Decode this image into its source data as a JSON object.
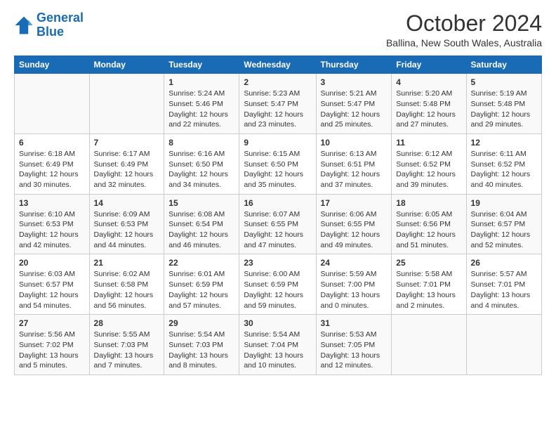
{
  "logo": {
    "line1": "General",
    "line2": "Blue"
  },
  "title": "October 2024",
  "location": "Ballina, New South Wales, Australia",
  "days_of_week": [
    "Sunday",
    "Monday",
    "Tuesday",
    "Wednesday",
    "Thursday",
    "Friday",
    "Saturday"
  ],
  "weeks": [
    [
      {
        "day": "",
        "info": ""
      },
      {
        "day": "",
        "info": ""
      },
      {
        "day": "1",
        "info": "Sunrise: 5:24 AM\nSunset: 5:46 PM\nDaylight: 12 hours and 22 minutes."
      },
      {
        "day": "2",
        "info": "Sunrise: 5:23 AM\nSunset: 5:47 PM\nDaylight: 12 hours and 23 minutes."
      },
      {
        "day": "3",
        "info": "Sunrise: 5:21 AM\nSunset: 5:47 PM\nDaylight: 12 hours and 25 minutes."
      },
      {
        "day": "4",
        "info": "Sunrise: 5:20 AM\nSunset: 5:48 PM\nDaylight: 12 hours and 27 minutes."
      },
      {
        "day": "5",
        "info": "Sunrise: 5:19 AM\nSunset: 5:48 PM\nDaylight: 12 hours and 29 minutes."
      }
    ],
    [
      {
        "day": "6",
        "info": "Sunrise: 6:18 AM\nSunset: 6:49 PM\nDaylight: 12 hours and 30 minutes."
      },
      {
        "day": "7",
        "info": "Sunrise: 6:17 AM\nSunset: 6:49 PM\nDaylight: 12 hours and 32 minutes."
      },
      {
        "day": "8",
        "info": "Sunrise: 6:16 AM\nSunset: 6:50 PM\nDaylight: 12 hours and 34 minutes."
      },
      {
        "day": "9",
        "info": "Sunrise: 6:15 AM\nSunset: 6:50 PM\nDaylight: 12 hours and 35 minutes."
      },
      {
        "day": "10",
        "info": "Sunrise: 6:13 AM\nSunset: 6:51 PM\nDaylight: 12 hours and 37 minutes."
      },
      {
        "day": "11",
        "info": "Sunrise: 6:12 AM\nSunset: 6:52 PM\nDaylight: 12 hours and 39 minutes."
      },
      {
        "day": "12",
        "info": "Sunrise: 6:11 AM\nSunset: 6:52 PM\nDaylight: 12 hours and 40 minutes."
      }
    ],
    [
      {
        "day": "13",
        "info": "Sunrise: 6:10 AM\nSunset: 6:53 PM\nDaylight: 12 hours and 42 minutes."
      },
      {
        "day": "14",
        "info": "Sunrise: 6:09 AM\nSunset: 6:53 PM\nDaylight: 12 hours and 44 minutes."
      },
      {
        "day": "15",
        "info": "Sunrise: 6:08 AM\nSunset: 6:54 PM\nDaylight: 12 hours and 46 minutes."
      },
      {
        "day": "16",
        "info": "Sunrise: 6:07 AM\nSunset: 6:55 PM\nDaylight: 12 hours and 47 minutes."
      },
      {
        "day": "17",
        "info": "Sunrise: 6:06 AM\nSunset: 6:55 PM\nDaylight: 12 hours and 49 minutes."
      },
      {
        "day": "18",
        "info": "Sunrise: 6:05 AM\nSunset: 6:56 PM\nDaylight: 12 hours and 51 minutes."
      },
      {
        "day": "19",
        "info": "Sunrise: 6:04 AM\nSunset: 6:57 PM\nDaylight: 12 hours and 52 minutes."
      }
    ],
    [
      {
        "day": "20",
        "info": "Sunrise: 6:03 AM\nSunset: 6:57 PM\nDaylight: 12 hours and 54 minutes."
      },
      {
        "day": "21",
        "info": "Sunrise: 6:02 AM\nSunset: 6:58 PM\nDaylight: 12 hours and 56 minutes."
      },
      {
        "day": "22",
        "info": "Sunrise: 6:01 AM\nSunset: 6:59 PM\nDaylight: 12 hours and 57 minutes."
      },
      {
        "day": "23",
        "info": "Sunrise: 6:00 AM\nSunset: 6:59 PM\nDaylight: 12 hours and 59 minutes."
      },
      {
        "day": "24",
        "info": "Sunrise: 5:59 AM\nSunset: 7:00 PM\nDaylight: 13 hours and 0 minutes."
      },
      {
        "day": "25",
        "info": "Sunrise: 5:58 AM\nSunset: 7:01 PM\nDaylight: 13 hours and 2 minutes."
      },
      {
        "day": "26",
        "info": "Sunrise: 5:57 AM\nSunset: 7:01 PM\nDaylight: 13 hours and 4 minutes."
      }
    ],
    [
      {
        "day": "27",
        "info": "Sunrise: 5:56 AM\nSunset: 7:02 PM\nDaylight: 13 hours and 5 minutes."
      },
      {
        "day": "28",
        "info": "Sunrise: 5:55 AM\nSunset: 7:03 PM\nDaylight: 13 hours and 7 minutes."
      },
      {
        "day": "29",
        "info": "Sunrise: 5:54 AM\nSunset: 7:03 PM\nDaylight: 13 hours and 8 minutes."
      },
      {
        "day": "30",
        "info": "Sunrise: 5:54 AM\nSunset: 7:04 PM\nDaylight: 13 hours and 10 minutes."
      },
      {
        "day": "31",
        "info": "Sunrise: 5:53 AM\nSunset: 7:05 PM\nDaylight: 13 hours and 12 minutes."
      },
      {
        "day": "",
        "info": ""
      },
      {
        "day": "",
        "info": ""
      }
    ]
  ]
}
